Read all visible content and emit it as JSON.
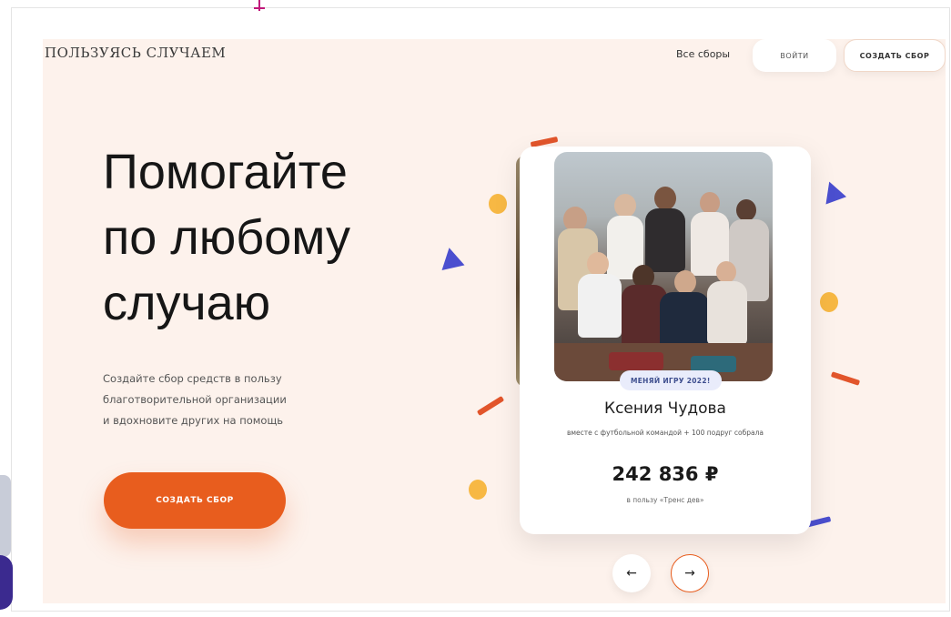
{
  "header": {
    "logo": "ПОЛЬЗУЯСЬ СЛУЧАЕМ",
    "nav_all_campaigns": "Все сборы",
    "login_label": "ВОЙТИ",
    "create_label": "СОЗДАТЬ СБОР"
  },
  "hero": {
    "title_lines": [
      "Помогайте",
      "по любому",
      "случаю"
    ],
    "description_lines": [
      "Создайте сбор средств в пользу",
      "благотворительной организации",
      "и вдохновите других на помощь"
    ],
    "cta_label": "СОЗДАТЬ СБОР"
  },
  "campaign_card": {
    "badge": "МЕНЯЙ ИГРУ 2022!",
    "name": "Ксения Чудова",
    "subtitle": "вместе с футбольной командой + 100 подруг собрала",
    "amount": "242 836 ₽",
    "beneficiary": "в пользу «Тренс дев»"
  },
  "carousel": {
    "prev_icon": "arrow-left-icon",
    "next_icon": "arrow-right-icon"
  },
  "colors": {
    "accent": "#e85d1e",
    "background": "#fdf2ec",
    "confetti_yellow": "#f7b844",
    "confetti_blue": "#4b4fcf",
    "confetti_red": "#e2552b"
  }
}
